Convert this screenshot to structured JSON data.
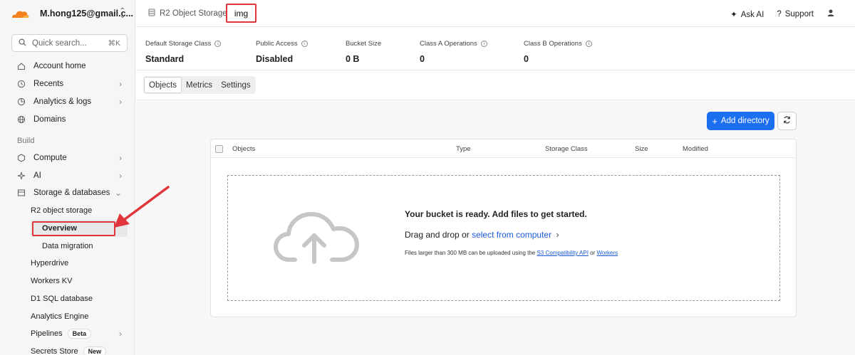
{
  "account": {
    "name": "M.hong125@gmail.c..."
  },
  "search": {
    "placeholder": "Quick search...",
    "shortcut": "⌘K"
  },
  "sidebar": {
    "top_items": [
      {
        "label": "Account home",
        "icon": "home-icon"
      },
      {
        "label": "Recents",
        "icon": "clock-icon"
      },
      {
        "label": "Analytics & logs",
        "icon": "chart-icon"
      },
      {
        "label": "Domains",
        "icon": "globe-icon"
      }
    ],
    "section_build": "Build",
    "build_items": [
      {
        "label": "Compute",
        "icon": "compute-icon"
      },
      {
        "label": "AI",
        "icon": "ai-icon"
      },
      {
        "label": "Storage & databases",
        "icon": "storage-icon"
      }
    ],
    "storage_sub": [
      "R2 object storage",
      "Overview",
      "Data migration",
      "Hyperdrive",
      "Workers KV",
      "D1 SQL database",
      "Analytics Engine",
      "Pipelines",
      "Secrets Store"
    ],
    "badges": {
      "pipelines": "Beta",
      "secrets": "New"
    }
  },
  "breadcrumb": {
    "parent": "R2 Object Storage",
    "current": "img"
  },
  "topbar": {
    "ask_ai": "Ask AI",
    "support": "Support"
  },
  "stats": [
    {
      "label": "Default Storage Class",
      "value": "Standard"
    },
    {
      "label": "Public Access",
      "value": "Disabled"
    },
    {
      "label": "Bucket Size",
      "value": "0 B"
    },
    {
      "label": "Class A Operations",
      "value": "0"
    },
    {
      "label": "Class B Operations",
      "value": "0"
    }
  ],
  "tabs": [
    "Objects",
    "Metrics",
    "Settings"
  ],
  "actions": {
    "add_directory": "Add directory"
  },
  "table": {
    "columns": [
      "Objects",
      "Type",
      "Storage Class",
      "Size",
      "Modified"
    ]
  },
  "dropzone": {
    "title": "Your bucket is ready. Add files to get started.",
    "drag_prefix": "Drag and drop or ",
    "drag_link": "select from computer",
    "note_prefix": "Files larger than 300 MB can be uploaded using the ",
    "note_link1": "S3 Compatibility API",
    "note_or": " or ",
    "note_link2": "Workers"
  },
  "colors": {
    "accent": "#1d6ff1",
    "annotation": "#e0353a",
    "brand": "#f48120"
  }
}
